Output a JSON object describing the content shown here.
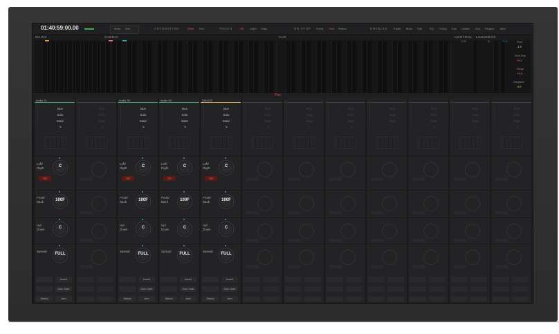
{
  "topbar": {
    "timecode": "01:40:59:00.00",
    "mute_label": "Mute",
    "dim_label": "Dim",
    "automation": {
      "label": "AUTOMATION",
      "buttons": [
        "Write",
        "Trim"
      ]
    },
    "touch": {
      "label": "TOUCH",
      "buttons": [
        "Off",
        "Latch",
        "Snap"
      ]
    },
    "on_stop": {
      "label": "ON STOP",
      "buttons": [
        "Event",
        "Hold",
        "Return"
      ]
    },
    "enables": {
      "label": "ENABLES",
      "buttons": [
        "Fader",
        "Mute",
        "Pan",
        "EQ",
        "Comp",
        "Exp",
        "Limiter",
        "Aux",
        "Plugins",
        "Misc"
      ]
    }
  },
  "sections": {
    "mains": "MAINS",
    "submix": "SUBMIX",
    "aux": "AUX",
    "control": "CONTROL",
    "loudness": "LOUDNESS"
  },
  "loudness": {
    "short_value": "0.00",
    "m_label": "M",
    "s_value": "+1.3",
    "items": [
      {
        "label": "Short",
        "value": "-1.0",
        "color": "#e3a33c"
      },
      {
        "label": "Short Max",
        "value": "+0.1",
        "color": "#e0553c"
      },
      {
        "label": "Range",
        "value": "+7.0",
        "color": "#e0553c"
      },
      {
        "label": "Integrated",
        "value": "-0.7",
        "color": "#e3a33c"
      }
    ]
  },
  "pan_title": "Pan",
  "strip_buttons": {
    "bus": "Bus",
    "solo": "Solo",
    "mute": "Mute"
  },
  "strips": [
    {
      "name": "Audio 21",
      "active": true,
      "left_right": "C",
      "front_back": "100F",
      "up_down": "C",
      "spread": "FULL"
    },
    {
      "name": "",
      "active": false
    },
    {
      "name": "Audio 30",
      "active": true,
      "left_right": "C",
      "front_back": "100F",
      "up_down": "C",
      "spread": "FULL"
    },
    {
      "name": "Audio 40",
      "active": true,
      "left_right": "C",
      "front_back": "100F",
      "up_down": "C",
      "spread": "FULL"
    },
    {
      "name": "DIALOG",
      "active": true,
      "left_right": "C",
      "front_back": "100F",
      "up_down": "C",
      "spread": "FULL"
    },
    {
      "name": "",
      "active": false
    },
    {
      "name": "",
      "active": false
    },
    {
      "name": "",
      "active": false
    },
    {
      "name": "",
      "active": false
    },
    {
      "name": "",
      "active": false
    },
    {
      "name": "",
      "active": false
    },
    {
      "name": "",
      "active": false
    }
  ],
  "knob_labels": {
    "left_right": "Left/ Right",
    "front_back": "Front/ Back",
    "up_down": "Up/ Down",
    "spread": "Spread",
    "on": "On"
  },
  "bottom_buttons": {
    "insert": "Insert",
    "solo_safe": "Solo Safe",
    "select": "Select",
    "arm": "Arm"
  },
  "colors": {
    "accent_red": "#d94f2b",
    "active_green": "#2fa76a",
    "dialog_gold": "#d9a23a",
    "knob_dot": "#2aa7d6"
  }
}
